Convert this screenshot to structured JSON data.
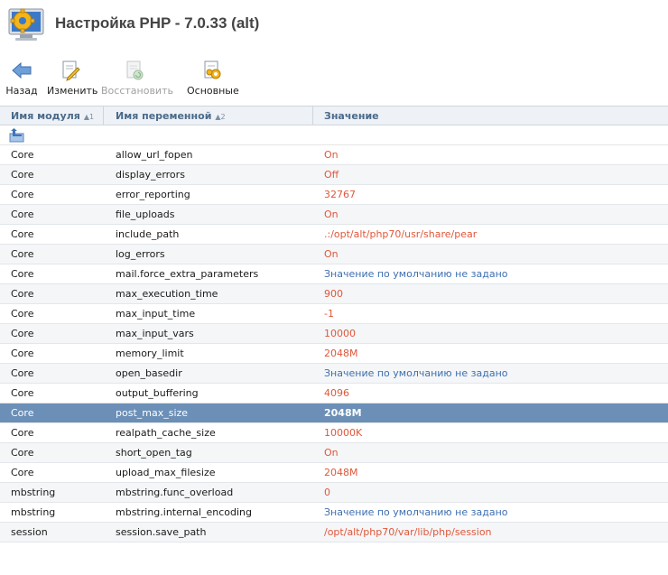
{
  "header": {
    "title": "Настройка PHP - 7.0.33 (alt)"
  },
  "toolbar": {
    "back": "Назад",
    "edit": "Изменить",
    "restore": "Восстановить",
    "basic": "Основные"
  },
  "columns": {
    "module": "Имя модуля",
    "module_sort": "▲1",
    "variable": "Имя переменной",
    "variable_sort": "▲2",
    "value": "Значение"
  },
  "colors": {
    "value_default": "#e0573a",
    "value_unset": "#3f6fb0",
    "selected_row": "#6b8fb6"
  },
  "rows": [
    {
      "module": "Core",
      "name": "allow_url_fopen",
      "value": "On",
      "kind": "set"
    },
    {
      "module": "Core",
      "name": "display_errors",
      "value": "Off",
      "kind": "set"
    },
    {
      "module": "Core",
      "name": "error_reporting",
      "value": "32767",
      "kind": "set"
    },
    {
      "module": "Core",
      "name": "file_uploads",
      "value": "On",
      "kind": "set"
    },
    {
      "module": "Core",
      "name": "include_path",
      "value": ".:/opt/alt/php70/usr/share/pear",
      "kind": "set"
    },
    {
      "module": "Core",
      "name": "log_errors",
      "value": "On",
      "kind": "set"
    },
    {
      "module": "Core",
      "name": "mail.force_extra_parameters",
      "value": "Значение по умолчанию не задано",
      "kind": "unset"
    },
    {
      "module": "Core",
      "name": "max_execution_time",
      "value": "900",
      "kind": "set"
    },
    {
      "module": "Core",
      "name": "max_input_time",
      "value": "-1",
      "kind": "set"
    },
    {
      "module": "Core",
      "name": "max_input_vars",
      "value": "10000",
      "kind": "set"
    },
    {
      "module": "Core",
      "name": "memory_limit",
      "value": "2048M",
      "kind": "set"
    },
    {
      "module": "Core",
      "name": "open_basedir",
      "value": "Значение по умолчанию не задано",
      "kind": "unset"
    },
    {
      "module": "Core",
      "name": "output_buffering",
      "value": "4096",
      "kind": "set"
    },
    {
      "module": "Core",
      "name": "post_max_size",
      "value": "2048M",
      "kind": "set",
      "selected": true
    },
    {
      "module": "Core",
      "name": "realpath_cache_size",
      "value": "10000K",
      "kind": "set"
    },
    {
      "module": "Core",
      "name": "short_open_tag",
      "value": "On",
      "kind": "set"
    },
    {
      "module": "Core",
      "name": "upload_max_filesize",
      "value": "2048M",
      "kind": "set"
    },
    {
      "module": "mbstring",
      "name": "mbstring.func_overload",
      "value": "0",
      "kind": "set"
    },
    {
      "module": "mbstring",
      "name": "mbstring.internal_encoding",
      "value": "Значение по умолчанию не задано",
      "kind": "unset"
    },
    {
      "module": "session",
      "name": "session.save_path",
      "value": "/opt/alt/php70/var/lib/php/session",
      "kind": "set"
    }
  ]
}
